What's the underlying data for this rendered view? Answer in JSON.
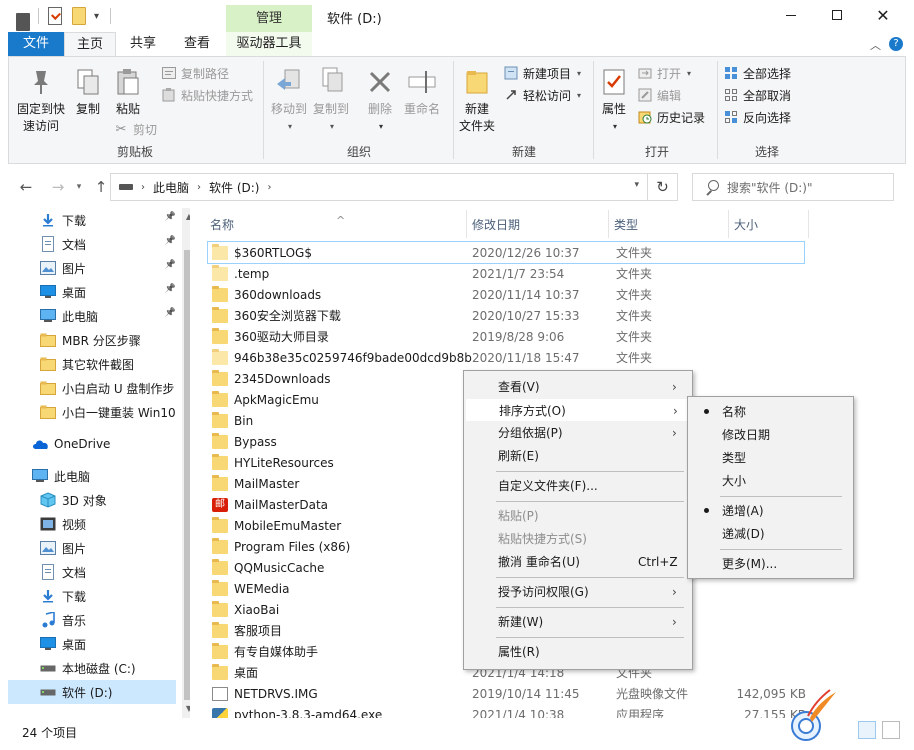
{
  "window": {
    "title": "软件 (D:)",
    "context_tab_group": "管理"
  },
  "tabs": {
    "file": "文件",
    "home": "主页",
    "share": "共享",
    "view": "查看",
    "drive_tools": "驱动器工具"
  },
  "ribbon": {
    "clipboard": {
      "label": "剪贴板",
      "pin_quick_access": "固定到快速访问",
      "copy": "复制",
      "paste": "粘贴",
      "copy_path": "复制路径",
      "paste_shortcut": "粘贴快捷方式",
      "cut": "剪切"
    },
    "organize": {
      "label": "组织",
      "move_to": "移动到",
      "copy_to": "复制到",
      "delete": "删除",
      "rename": "重命名"
    },
    "new": {
      "label": "新建",
      "new_folder": "新建\n文件夹",
      "new_item": "新建项目",
      "easy_access": "轻松访问"
    },
    "open": {
      "label": "打开",
      "properties": "属性",
      "open": "打开",
      "edit": "编辑",
      "history": "历史记录"
    },
    "select": {
      "label": "选择",
      "select_all": "全部选择",
      "select_none": "全部取消",
      "invert": "反向选择"
    }
  },
  "address": {
    "crumbs": [
      "此电脑",
      "软件 (D:)"
    ],
    "search_placeholder": "搜索\"软件 (D:)\""
  },
  "navpane": {
    "items": [
      {
        "label": "下载",
        "icon": "download-icon",
        "pinned": true
      },
      {
        "label": "文档",
        "icon": "document-icon",
        "pinned": true
      },
      {
        "label": "图片",
        "icon": "picture-icon",
        "pinned": true
      },
      {
        "label": "桌面",
        "icon": "desktop-icon",
        "pinned": true
      },
      {
        "label": "此电脑",
        "icon": "computer-icon",
        "pinned": true
      },
      {
        "label": "MBR 分区步骤",
        "icon": "folder-icon",
        "pinned": false
      },
      {
        "label": "其它软件截图",
        "icon": "folder-icon",
        "pinned": false
      },
      {
        "label": "小白启动 U 盘制作步",
        "icon": "folder-icon",
        "pinned": false
      },
      {
        "label": "小白一键重装 Win10",
        "icon": "folder-icon",
        "pinned": false
      },
      {
        "label": "OneDrive",
        "icon": "cloud-icon",
        "pinned": false
      },
      {
        "label": "此电脑",
        "icon": "computer-icon",
        "pinned": false
      },
      {
        "label": "3D 对象",
        "icon": "cube-icon",
        "pinned": false
      },
      {
        "label": "视频",
        "icon": "video-icon",
        "pinned": false
      },
      {
        "label": "图片",
        "icon": "picture-icon",
        "pinned": false
      },
      {
        "label": "文档",
        "icon": "document-icon",
        "pinned": false
      },
      {
        "label": "下载",
        "icon": "download-icon",
        "pinned": false
      },
      {
        "label": "音乐",
        "icon": "music-icon",
        "pinned": false
      },
      {
        "label": "桌面",
        "icon": "desktop-icon",
        "pinned": false
      },
      {
        "label": "本地磁盘 (C:)",
        "icon": "drive-icon",
        "pinned": false
      },
      {
        "label": "软件 (D:)",
        "icon": "drive-icon",
        "pinned": false
      }
    ]
  },
  "filelist": {
    "columns": {
      "name": "名称",
      "date": "修改日期",
      "type": "类型",
      "size": "大小"
    },
    "rows": [
      {
        "name": "$360RTLOG$",
        "date": "2020/12/26 10:37",
        "type": "文件夹",
        "size": "",
        "icon": "folder-light"
      },
      {
        "name": ".temp",
        "date": "2021/1/7 23:54",
        "type": "文件夹",
        "size": "",
        "icon": "folder-light"
      },
      {
        "name": "360downloads",
        "date": "2020/11/14 10:37",
        "type": "文件夹",
        "size": "",
        "icon": "folder"
      },
      {
        "name": "360安全浏览器下载",
        "date": "2020/10/27 15:33",
        "type": "文件夹",
        "size": "",
        "icon": "folder"
      },
      {
        "name": "360驱动大师目录",
        "date": "2019/8/28 9:06",
        "type": "文件夹",
        "size": "",
        "icon": "folder"
      },
      {
        "name": "946b38e35c0259746f9bade00dcd9b8b",
        "date": "2020/11/18 15:47",
        "type": "文件夹",
        "size": "",
        "icon": "folder-light"
      },
      {
        "name": "2345Downloads",
        "date": "",
        "type": "",
        "size": "",
        "icon": "folder"
      },
      {
        "name": "ApkMagicEmu",
        "date": "",
        "type": "",
        "size": "",
        "icon": "folder"
      },
      {
        "name": "Bin",
        "date": "",
        "type": "",
        "size": "",
        "icon": "folder"
      },
      {
        "name": "Bypass",
        "date": "",
        "type": "",
        "size": "",
        "icon": "folder"
      },
      {
        "name": "HYLiteResources",
        "date": "",
        "type": "",
        "size": "",
        "icon": "folder"
      },
      {
        "name": "MailMaster",
        "date": "",
        "type": "",
        "size": "",
        "icon": "folder"
      },
      {
        "name": "MailMasterData",
        "date": "",
        "type": "",
        "size": "",
        "icon": "app-red"
      },
      {
        "name": "MobileEmuMaster",
        "date": "",
        "type": "",
        "size": "",
        "icon": "folder"
      },
      {
        "name": "Program Files (x86)",
        "date": "",
        "type": "",
        "size": "",
        "icon": "folder"
      },
      {
        "name": "QQMusicCache",
        "date": "",
        "type": "",
        "size": "",
        "icon": "folder"
      },
      {
        "name": "WEMedia",
        "date": "",
        "type": "",
        "size": "",
        "icon": "folder"
      },
      {
        "name": "XiaoBai",
        "date": "",
        "type": "",
        "size": "",
        "icon": "folder"
      },
      {
        "name": "客服项目",
        "date": "",
        "type": "",
        "size": "",
        "icon": "folder"
      },
      {
        "name": "有专自媒体助手",
        "date": "",
        "type": "",
        "size": "",
        "icon": "folder"
      },
      {
        "name": "桌面",
        "date": "2021/1/4 14:18",
        "type": "文件夹",
        "size": "",
        "icon": "folder"
      },
      {
        "name": "NETDRVS.IMG",
        "date": "2019/10/14 11:45",
        "type": "光盘映像文件",
        "size": "142,095 KB",
        "icon": "file"
      },
      {
        "name": "python-3.8.3-amd64.exe",
        "date": "2021/1/4 10:38",
        "type": "应用程序",
        "size": "27,155 KB",
        "icon": "python"
      }
    ]
  },
  "context_menu": {
    "items": [
      {
        "label": "查看(V)",
        "submenu": true
      },
      {
        "label": "排序方式(O)",
        "submenu": true
      },
      {
        "label": "分组依据(P)",
        "submenu": true
      },
      {
        "label": "刷新(E)"
      },
      {
        "label": "自定义文件夹(F)..."
      },
      {
        "label": "粘贴(P)",
        "disabled": true
      },
      {
        "label": "粘贴快捷方式(S)",
        "disabled": true
      },
      {
        "label": "撤消 重命名(U)",
        "shortcut": "Ctrl+Z"
      },
      {
        "label": "授予访问权限(G)",
        "submenu": true
      },
      {
        "label": "新建(W)",
        "submenu": true
      },
      {
        "label": "属性(R)"
      }
    ]
  },
  "sort_submenu": {
    "items": [
      {
        "label": "名称",
        "checked": true
      },
      {
        "label": "修改日期"
      },
      {
        "label": "类型"
      },
      {
        "label": "大小"
      },
      {
        "label": "递增(A)",
        "checked": true
      },
      {
        "label": "递减(D)"
      },
      {
        "label": "更多(M)..."
      }
    ]
  },
  "status": {
    "item_count": "24 个项目"
  },
  "colors": {
    "accent": "#1979ca",
    "selection": "#cce8ff",
    "context_tab": "#d8f1c6",
    "folder": "#f8d775"
  }
}
